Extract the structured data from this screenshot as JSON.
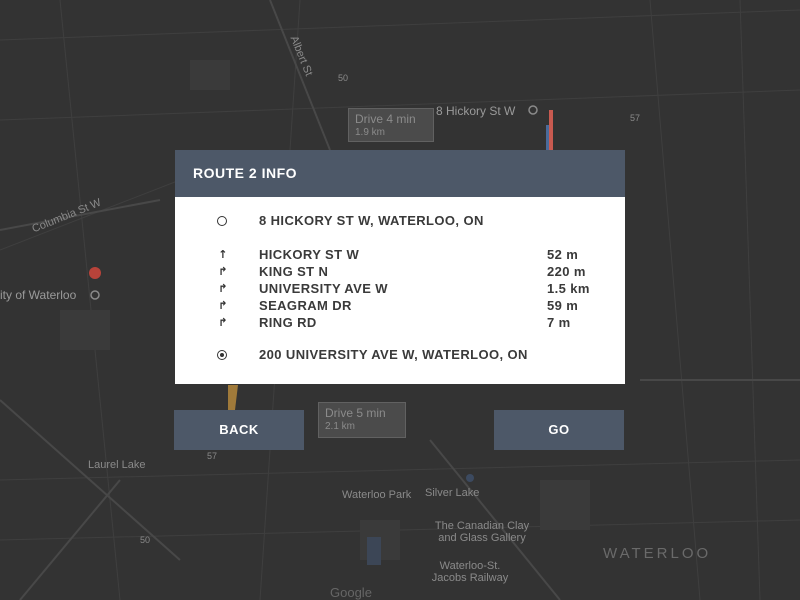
{
  "map": {
    "street_labels": [
      "Columbia St W",
      "Albert St",
      "Hickory St W"
    ],
    "place_labels": [
      "Waterloo Park",
      "Silver Lake",
      "The Canadian Clay and Glass Gallery",
      "Waterloo-St. Jacobs Railway",
      "Laurel Lake"
    ],
    "city_label": "WATERLOO",
    "origin_pin_label": "8 Hickory St W",
    "dest_pin_label": "ity of Waterloo",
    "drive_box_1": {
      "time": "Drive 4 min",
      "dist": "1.9 km"
    },
    "drive_box_2": {
      "time": "Drive 5 min",
      "dist": "2.1 km"
    },
    "road_numbers": [
      "50",
      "57",
      "57",
      "50"
    ],
    "attribution": "Google"
  },
  "panel": {
    "title": "ROUTE 2 INFO",
    "origin": "8 HICKORY ST W, WATERLOO, ON",
    "destination": "200 UNIVERSITY AVE W, WATERLOO, ON",
    "steps": [
      {
        "icon": "arrow-up-icon",
        "name": "HICKORY ST W",
        "dist": "52 m"
      },
      {
        "icon": "turn-right-icon",
        "name": "KING ST N",
        "dist": "220 m"
      },
      {
        "icon": "turn-right-icon",
        "name": "UNIVERSITY AVE W",
        "dist": "1.5 km"
      },
      {
        "icon": "turn-right-icon",
        "name": "SEAGRAM DR",
        "dist": "59 m"
      },
      {
        "icon": "turn-right-icon",
        "name": "RING RD",
        "dist": "7 m"
      }
    ]
  },
  "buttons": {
    "back_label": "BACK",
    "go_label": "GO"
  },
  "colors": {
    "header_bg": "#4d5868",
    "button_bg": "#4d5868",
    "panel_bg": "#ffffff",
    "map_bg": "#333333"
  }
}
